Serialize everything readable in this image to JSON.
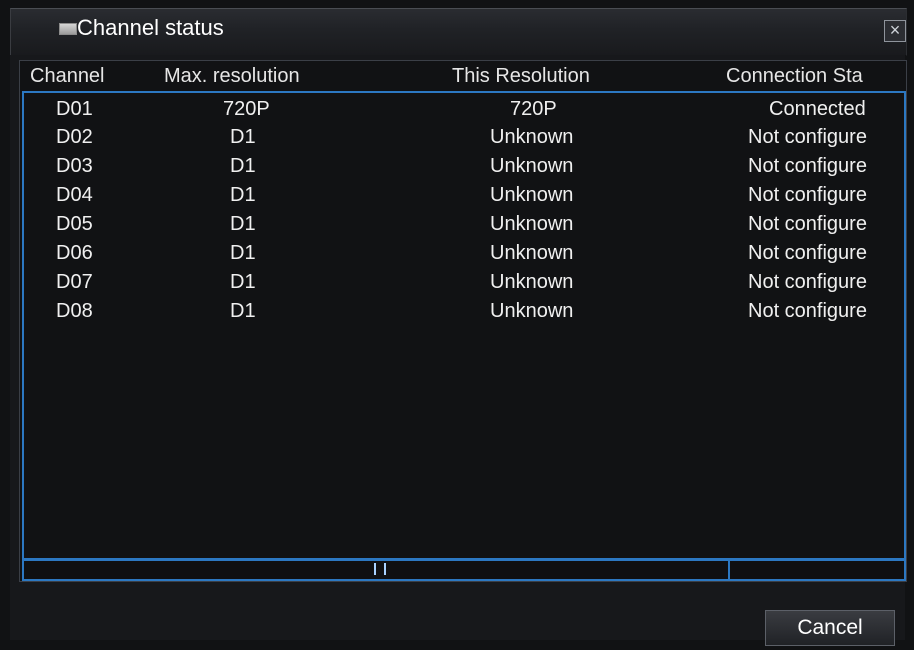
{
  "window": {
    "title": "Channel status",
    "close_label": "×"
  },
  "table": {
    "headers": [
      "Channel",
      "Max. resolution",
      "This Resolution",
      "Connection Sta"
    ],
    "rows": [
      {
        "channel": "D01",
        "max": "720P",
        "this": "720P",
        "status": "Connected"
      },
      {
        "channel": "D02",
        "max": "D1",
        "this": "Unknown",
        "status": "Not configure"
      },
      {
        "channel": "D03",
        "max": "D1",
        "this": "Unknown",
        "status": "Not configure"
      },
      {
        "channel": "D04",
        "max": "D1",
        "this": "Unknown",
        "status": "Not configure"
      },
      {
        "channel": "D05",
        "max": "D1",
        "this": "Unknown",
        "status": "Not configure"
      },
      {
        "channel": "D06",
        "max": "D1",
        "this": "Unknown",
        "status": "Not configure"
      },
      {
        "channel": "D07",
        "max": "D1",
        "this": "Unknown",
        "status": "Not configure"
      },
      {
        "channel": "D08",
        "max": "D1",
        "this": "Unknown",
        "status": "Not configure"
      }
    ]
  },
  "footer": {
    "cancel_label": "Cancel"
  }
}
